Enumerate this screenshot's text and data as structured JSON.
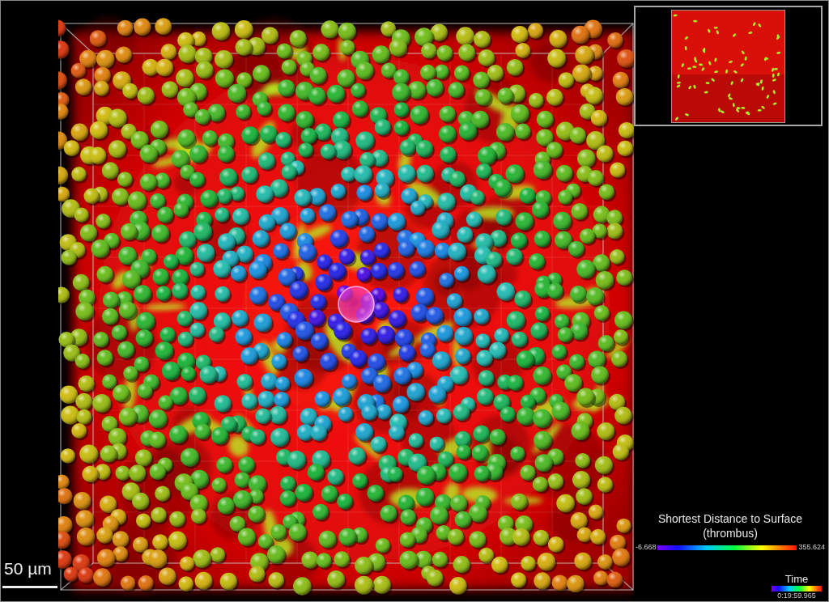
{
  "scale_bar": {
    "label": "50 µm"
  },
  "distance_legend": {
    "title": "Shortest Distance to Surface",
    "subtitle": "(thrombus)",
    "min": "-6.668",
    "max": "355.624"
  },
  "time_legend": {
    "title": "Time",
    "value": "0:19:59.965"
  }
}
